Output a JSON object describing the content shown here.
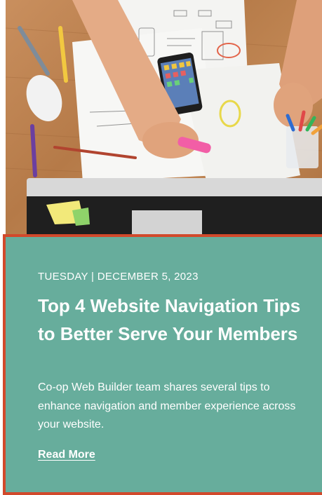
{
  "post": {
    "date": "TUESDAY | DECEMBER 5, 2023",
    "title": "Top 4 Website Navigation Tips to Better Serve Your Members",
    "excerpt": "Co-op Web Builder team shares several tips to enhance navigation and member experience across your website.",
    "read_more_label": "Read More"
  },
  "image": {
    "subject": "desk-with-wireframe-sketches-photo"
  },
  "colors": {
    "panel_background": "#67ad9c",
    "panel_border": "#d1492b",
    "text": "#ffffff"
  }
}
